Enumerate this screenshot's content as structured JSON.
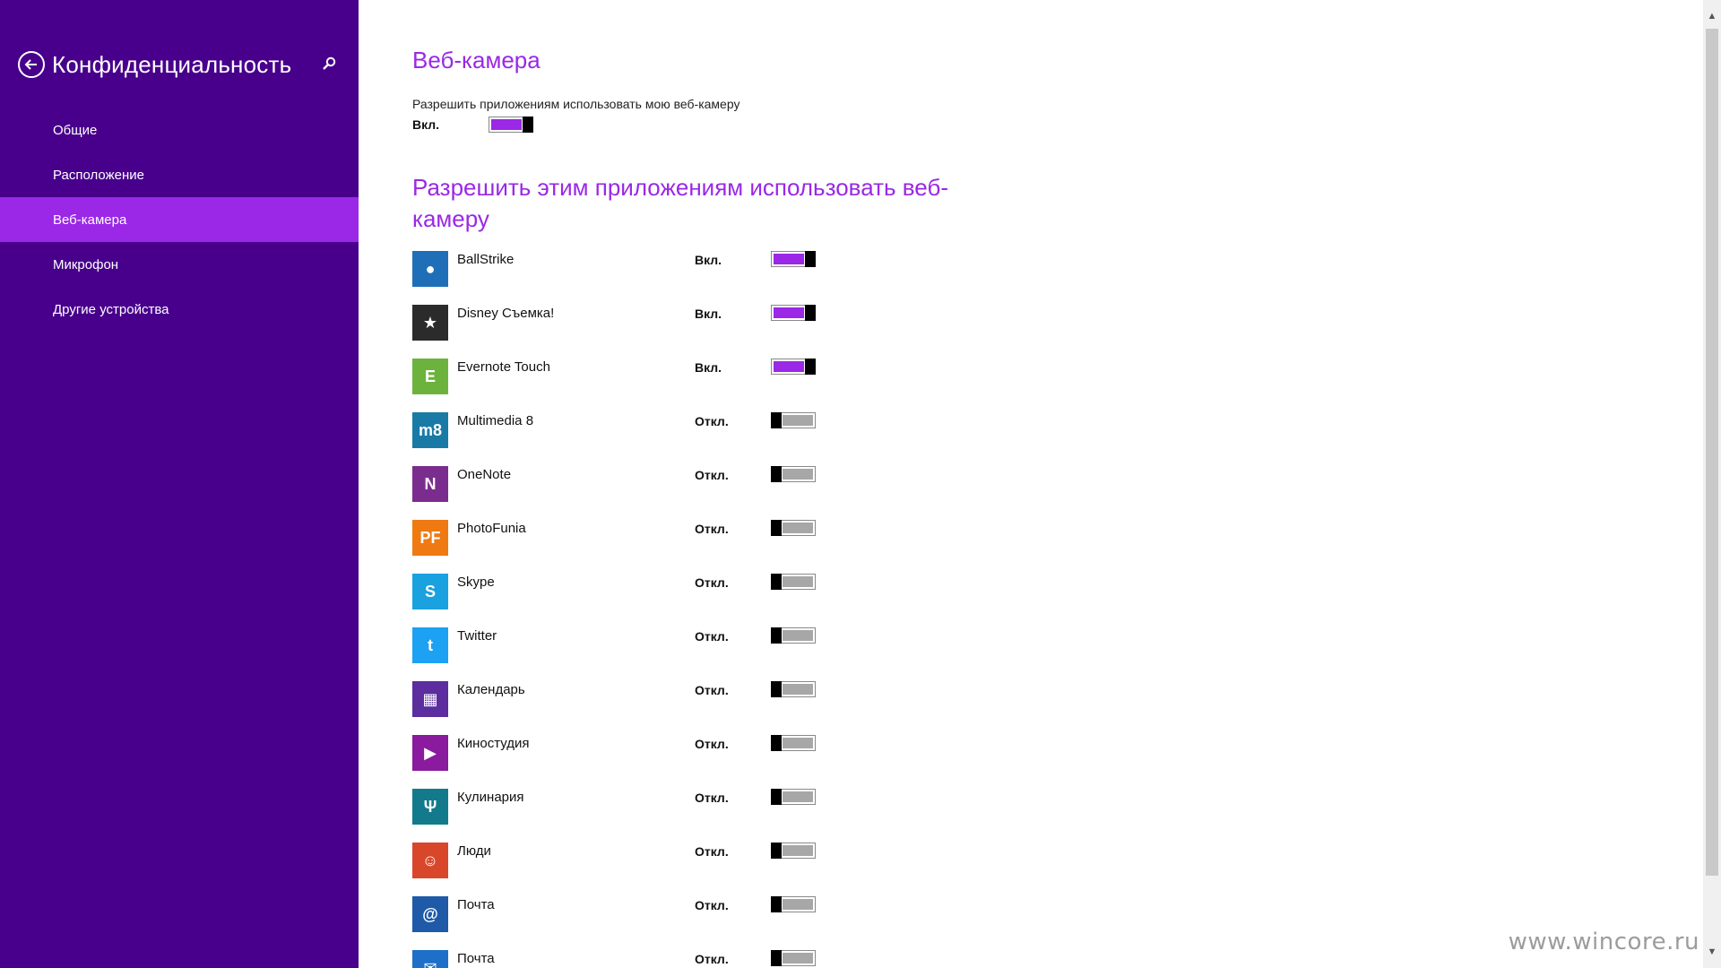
{
  "sidebar": {
    "title": "Конфиденциальность",
    "items": [
      {
        "label": "Общие",
        "active": false
      },
      {
        "label": "Расположение",
        "active": false
      },
      {
        "label": "Веб-камера",
        "active": true
      },
      {
        "label": "Микрофон",
        "active": false
      },
      {
        "label": "Другие устройства",
        "active": false
      }
    ]
  },
  "main": {
    "heading": "Веб-камера",
    "description": "Разрешить приложениям использовать мою веб-камеру",
    "master_state": "Вкл.",
    "master_on": true,
    "apps_heading": "Разрешить этим приложениям использовать веб-камеру",
    "apps": [
      {
        "name": "BallStrike",
        "state": "Вкл.",
        "on": true,
        "icon": "ballstrike-icon",
        "color": "#1f6fb8",
        "glyph": "●"
      },
      {
        "name": "Disney Съемка!",
        "state": "Вкл.",
        "on": true,
        "icon": "disney-icon",
        "color": "#2b2b2b",
        "glyph": "★"
      },
      {
        "name": "Evernote Touch",
        "state": "Вкл.",
        "on": true,
        "icon": "evernote-icon",
        "color": "#6cb33e",
        "glyph": "E"
      },
      {
        "name": "Multimedia 8",
        "state": "Откл.",
        "on": false,
        "icon": "multimedia-icon",
        "color": "#1a7aa6",
        "glyph": "m8"
      },
      {
        "name": "OneNote",
        "state": "Откл.",
        "on": false,
        "icon": "onenote-icon",
        "color": "#7b2d8f",
        "glyph": "N"
      },
      {
        "name": "PhotoFunia",
        "state": "Откл.",
        "on": false,
        "icon": "photofunia-icon",
        "color": "#f07a12",
        "glyph": "PF"
      },
      {
        "name": "Skype",
        "state": "Откл.",
        "on": false,
        "icon": "skype-icon",
        "color": "#1aa1e0",
        "glyph": "S"
      },
      {
        "name": "Twitter",
        "state": "Откл.",
        "on": false,
        "icon": "twitter-icon",
        "color": "#1da1f2",
        "glyph": "t"
      },
      {
        "name": "Календарь",
        "state": "Откл.",
        "on": false,
        "icon": "calendar-icon",
        "color": "#5b2d9e",
        "glyph": "▦"
      },
      {
        "name": "Киностудия",
        "state": "Откл.",
        "on": false,
        "icon": "movie-maker-icon",
        "color": "#8a1a9e",
        "glyph": "▶"
      },
      {
        "name": "Кулинария",
        "state": "Откл.",
        "on": false,
        "icon": "food-icon",
        "color": "#137a8c",
        "glyph": "Ψ"
      },
      {
        "name": "Люди",
        "state": "Откл.",
        "on": false,
        "icon": "people-icon",
        "color": "#d9472b",
        "glyph": "☺"
      },
      {
        "name": "Почта",
        "state": "Откл.",
        "on": false,
        "icon": "mail-at-icon",
        "color": "#1e5aa8",
        "glyph": "@"
      },
      {
        "name": "Почта",
        "state": "Откл.",
        "on": false,
        "icon": "mail-envelope-icon",
        "color": "#1e6fc8",
        "glyph": "✉"
      }
    ]
  },
  "watermark": "www.wincore.ru",
  "colors": {
    "sidebar_bg": "#48008c",
    "accent": "#9a28e6"
  }
}
